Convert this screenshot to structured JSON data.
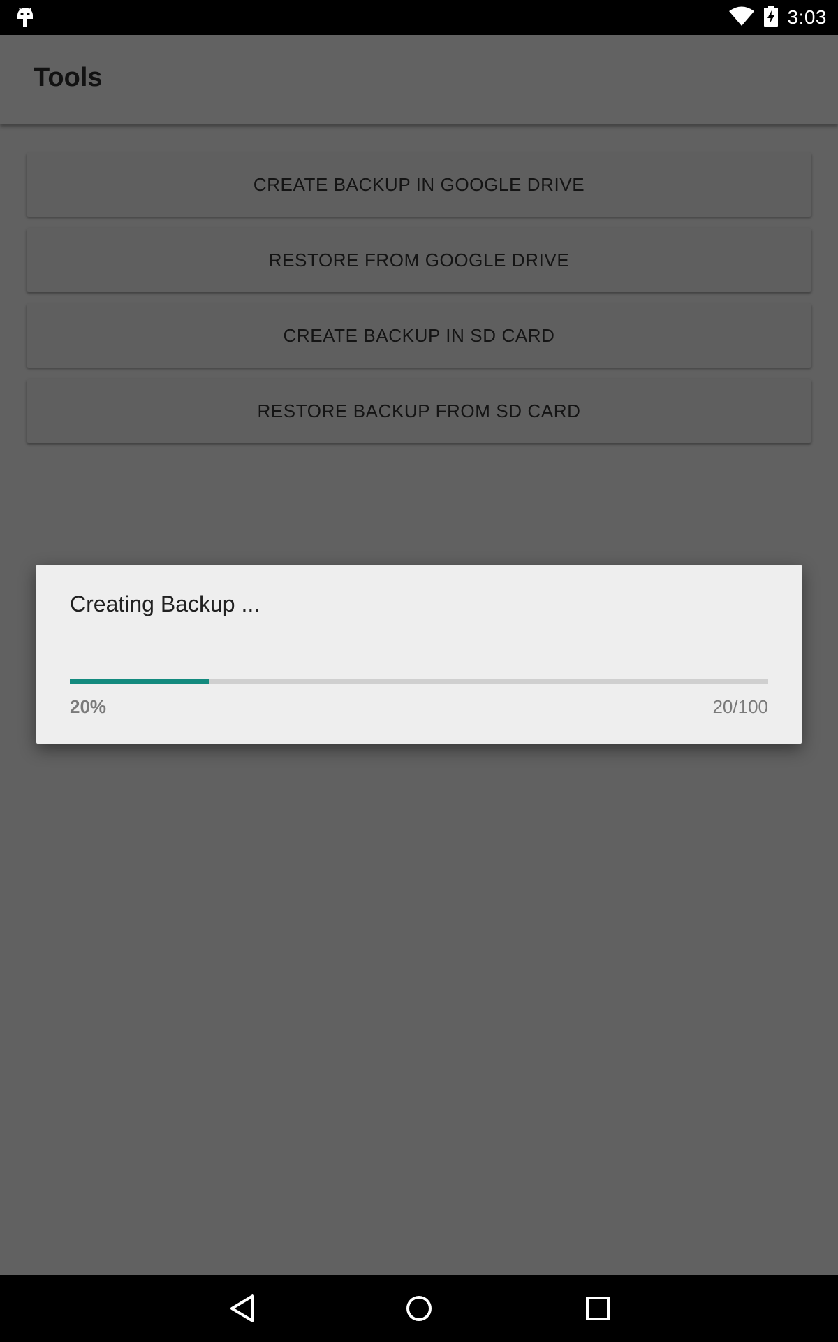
{
  "status_bar": {
    "time": "3:03",
    "icons": [
      "android-debug-icon",
      "wifi-icon",
      "battery-charging-icon"
    ]
  },
  "app_bar": {
    "title": "Tools"
  },
  "actions": [
    {
      "label": "CREATE BACKUP IN GOOGLE DRIVE"
    },
    {
      "label": "RESTORE FROM GOOGLE DRIVE"
    },
    {
      "label": "CREATE BACKUP IN SD CARD"
    },
    {
      "label": "RESTORE BACKUP FROM SD CARD"
    }
  ],
  "dialog": {
    "title": "Creating Backup ...",
    "progress_fraction": 0.2,
    "percent_text": "20%",
    "count_text": "20/100",
    "accent_color": "#138a7e"
  },
  "nav_bar": {
    "icons": [
      "back-icon",
      "home-icon",
      "recents-icon"
    ]
  }
}
